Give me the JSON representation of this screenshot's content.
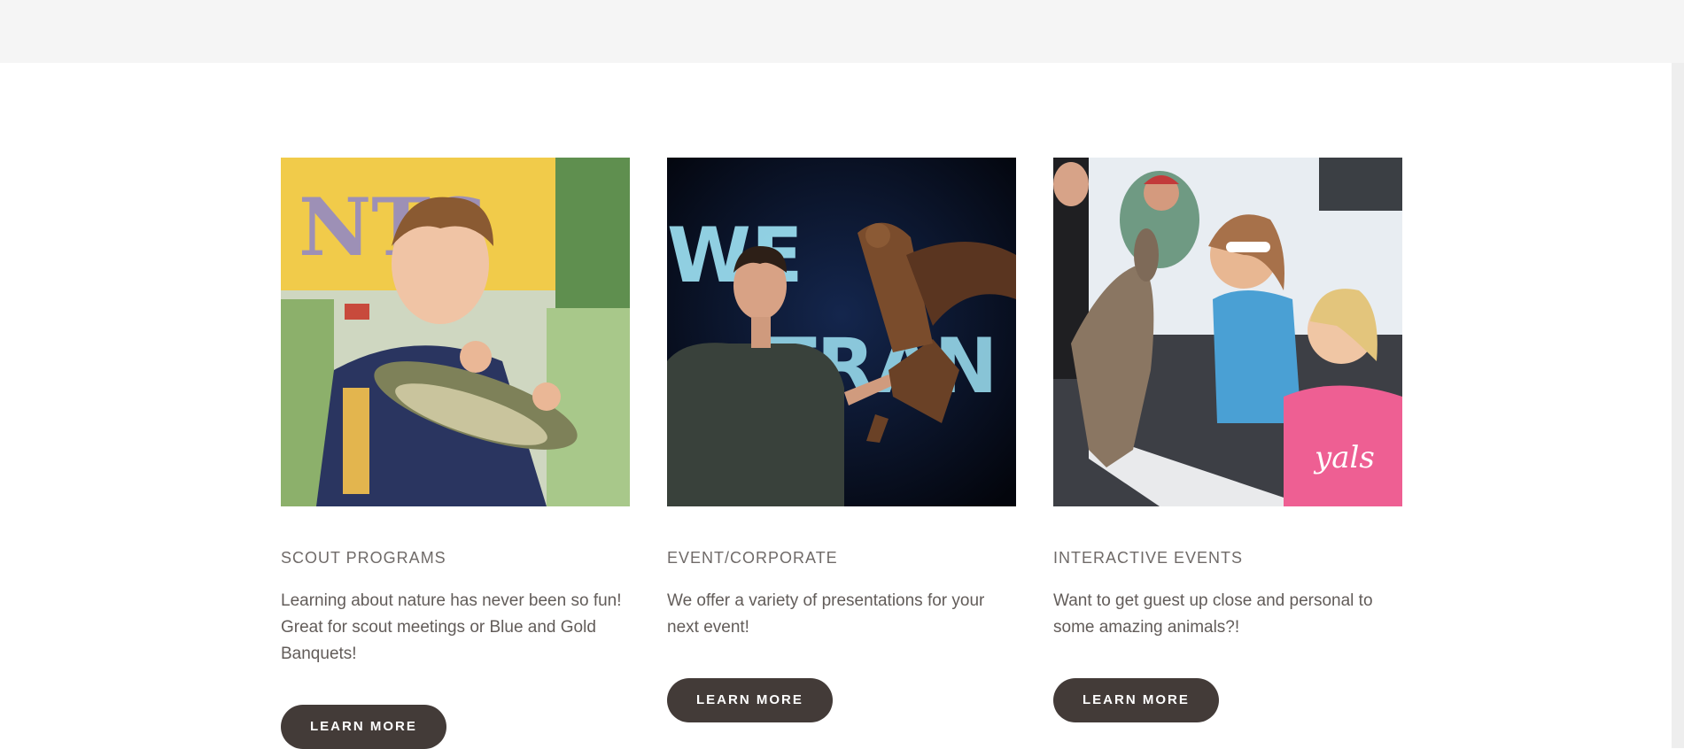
{
  "cards": [
    {
      "title": "SCOUT PROGRAMS",
      "description": "Learning about nature has never been so fun!  Great for scout meetings or Blue and Gold Banquets!",
      "button_label": "LEARN MORE",
      "image": "scout-boy-holding-alligator"
    },
    {
      "title": "EVENT/CORPORATE",
      "description": "We offer a variety of presentations for your next event!",
      "button_label": "LEARN MORE",
      "image": "presenter-with-owl"
    },
    {
      "title": "INTERACTIVE EVENTS",
      "description": "Want to get guest up close and personal to some amazing animals?!",
      "button_label": "LEARN MORE",
      "image": "kids-with-mara"
    }
  ],
  "colors": {
    "button_bg": "#433b38",
    "button_text": "#ffffff",
    "text": "#625c59",
    "band": "#f5f5f5"
  }
}
